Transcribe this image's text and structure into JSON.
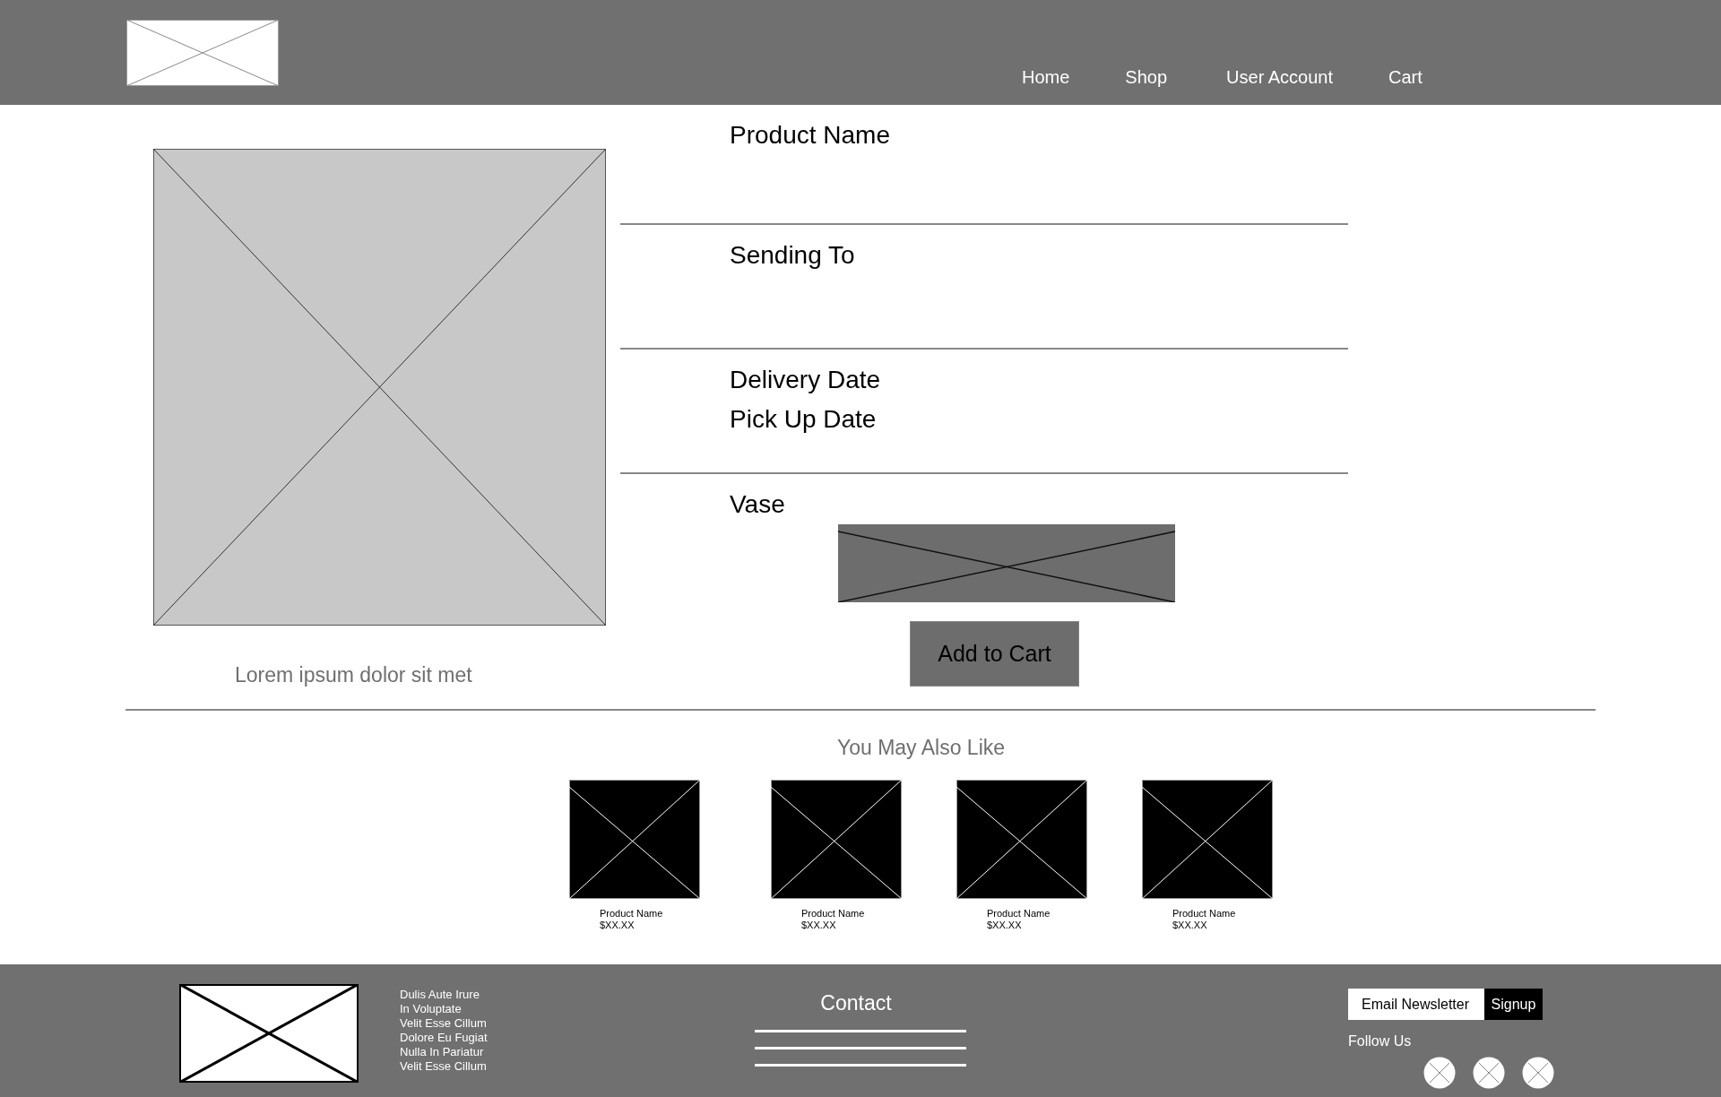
{
  "header": {
    "nav": [
      "Home",
      "Shop",
      "User Account",
      "Cart"
    ]
  },
  "product": {
    "sections": [
      {
        "labels": [
          "Product Name"
        ]
      },
      {
        "labels": [
          "Sending To"
        ]
      },
      {
        "labels": [
          "Delivery Date",
          "Pick Up Date"
        ]
      },
      {
        "labels": [
          "Vase"
        ]
      }
    ],
    "caption": "Lorem ipsum dolor sit met",
    "add_button": "Add to Cart"
  },
  "related": {
    "title": "You May Also Like",
    "items": [
      {
        "name": "Product Name",
        "price": "$XX.XX"
      },
      {
        "name": "Product Name",
        "price": "$XX.XX"
      },
      {
        "name": "Product Name",
        "price": "$XX.XX"
      },
      {
        "name": "Product Name",
        "price": "$XX.XX"
      }
    ]
  },
  "footer": {
    "links": [
      "Dulis Aute Irure",
      "In Voluptate",
      "Velit Esse Cillum",
      "Dolore Eu Fugiat",
      "Nulla In Pariatur",
      "Velit Esse Cillum"
    ],
    "contact_title": "Contact",
    "newsletter": {
      "placeholder": "Email Newsletter",
      "button": "Signup"
    },
    "follow_label": "Follow Us"
  }
}
